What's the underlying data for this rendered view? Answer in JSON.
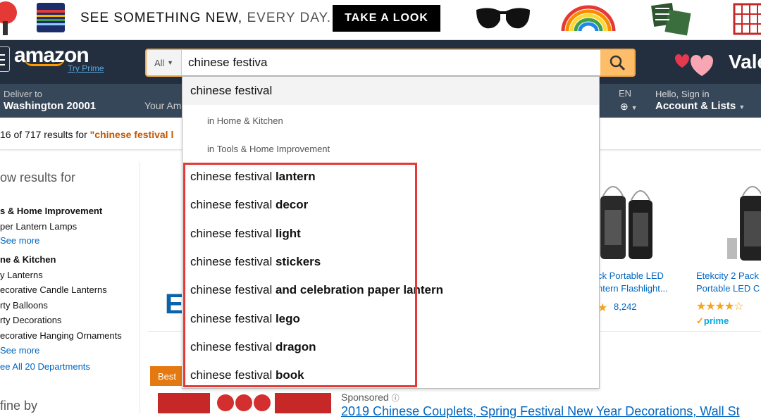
{
  "promo": {
    "tagline_main": "SEE SOMETHING NEW,",
    "tagline_rest": " EVERY DAY.",
    "cta": "TAKE A LOOK"
  },
  "header": {
    "logo": "amazon",
    "try_prime": "Try Prime",
    "search_category": "All",
    "search_value": "chinese festiva",
    "valentine": "Vale",
    "deliver_label": "Deliver to",
    "deliver_city": "Washington 20001",
    "your_am": "Your Am",
    "lang": "EN",
    "hello": "Hello, Sign in",
    "account": "Account & Lists"
  },
  "results": {
    "count_text": "16 of 717 results for ",
    "query_text": "\"chinese festival l"
  },
  "sidebar": {
    "heading": "ow results for",
    "items": [
      {
        "label": "s & Home Improvement",
        "style": "bold"
      },
      {
        "label": "per Lantern Lamps",
        "style": "plain"
      },
      {
        "label": "See more",
        "style": "link"
      },
      {
        "label": "ne & Kitchen",
        "style": "bold"
      },
      {
        "label": "y Lanterns",
        "style": "plain"
      },
      {
        "label": "ecorative Candle Lanterns",
        "style": "plain"
      },
      {
        "label": "rty Balloons",
        "style": "plain"
      },
      {
        "label": "rty Decorations",
        "style": "plain"
      },
      {
        "label": "ecorative Hanging Ornaments",
        "style": "plain"
      },
      {
        "label": "See more",
        "style": "link"
      },
      {
        "label": "ee All 20 Departments",
        "style": "link"
      }
    ],
    "refine": "fine by"
  },
  "products": [
    {
      "title_1": "ck Portable LED",
      "title_2": "ntern Flashlight...",
      "reviews": "8,242"
    },
    {
      "title_1": "Etekcity 2 Pack",
      "title_2": "Portable LED C",
      "prime": "prime"
    }
  ],
  "best_badge": "Best",
  "sponsored": "Sponsored",
  "sponsored_title": "2019 Chinese Couplets, Spring Festival New Year Decorations, Wall St",
  "letter_e": "E",
  "suggestions": {
    "first": {
      "prefix": "chinese festiva",
      "rest": "l"
    },
    "sub1": {
      "in": "in ",
      "dept": "Home & Kitchen"
    },
    "sub2": {
      "in": "in ",
      "dept": "Tools & Home Improvement"
    },
    "items": [
      {
        "prefix": "chinese festiva",
        "mid": "l",
        "bold": " lantern"
      },
      {
        "prefix": "chinese festiva",
        "mid": "l",
        "bold": " decor"
      },
      {
        "prefix": "chinese festiva",
        "mid": "l",
        "bold": " light"
      },
      {
        "prefix": "chinese festiva",
        "mid": "l",
        "bold": " stickers"
      },
      {
        "prefix": "chinese festiva",
        "mid": "l",
        "bold": " and celebration paper lantern"
      },
      {
        "prefix": "chinese festiva",
        "mid": "l",
        "bold": " lego"
      },
      {
        "prefix": "chinese festiva",
        "mid": "l",
        "bold": " dragon"
      },
      {
        "prefix": "chinese festiva",
        "mid": "l",
        "bold": " book"
      }
    ]
  },
  "colors": {
    "nav_top": "#232f3e",
    "nav_main": "#37475a",
    "search_button": "#febd69",
    "highlight_box": "#e53935",
    "query": "#c45500"
  }
}
